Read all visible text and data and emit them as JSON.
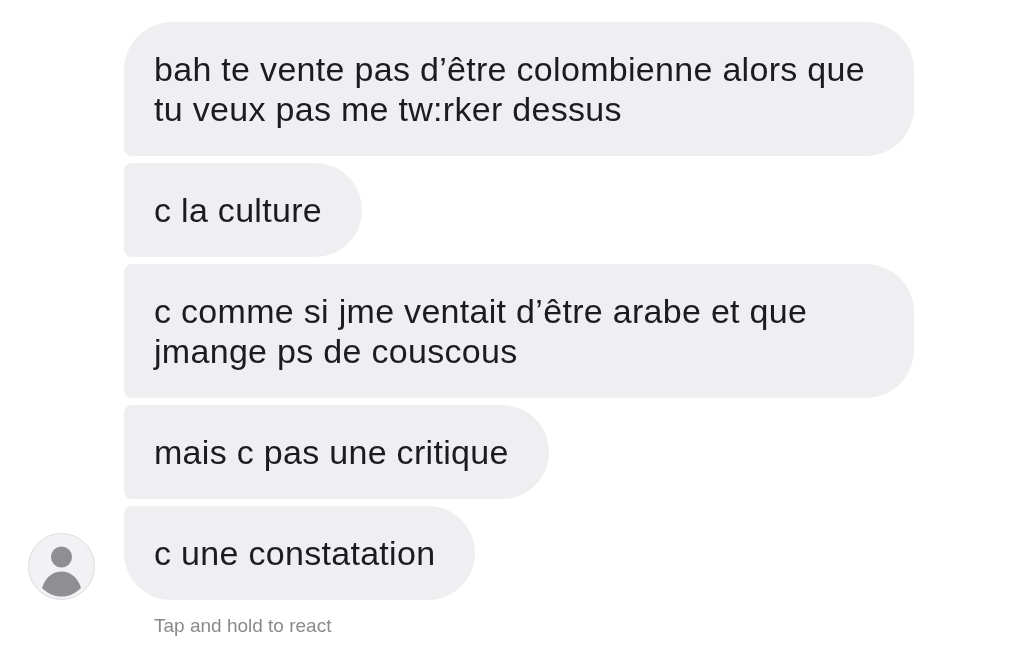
{
  "messages": [
    {
      "text": "bah te vente pas d’être colombienne alors que tu veux pas me tw:rker dessus"
    },
    {
      "text": "c la culture"
    },
    {
      "text": "c comme si jme ventait d’être arabe et que jmange ps de couscous"
    },
    {
      "text": "mais c pas une critique"
    },
    {
      "text": "c une constatation"
    }
  ],
  "hint": "Tap and hold to react"
}
